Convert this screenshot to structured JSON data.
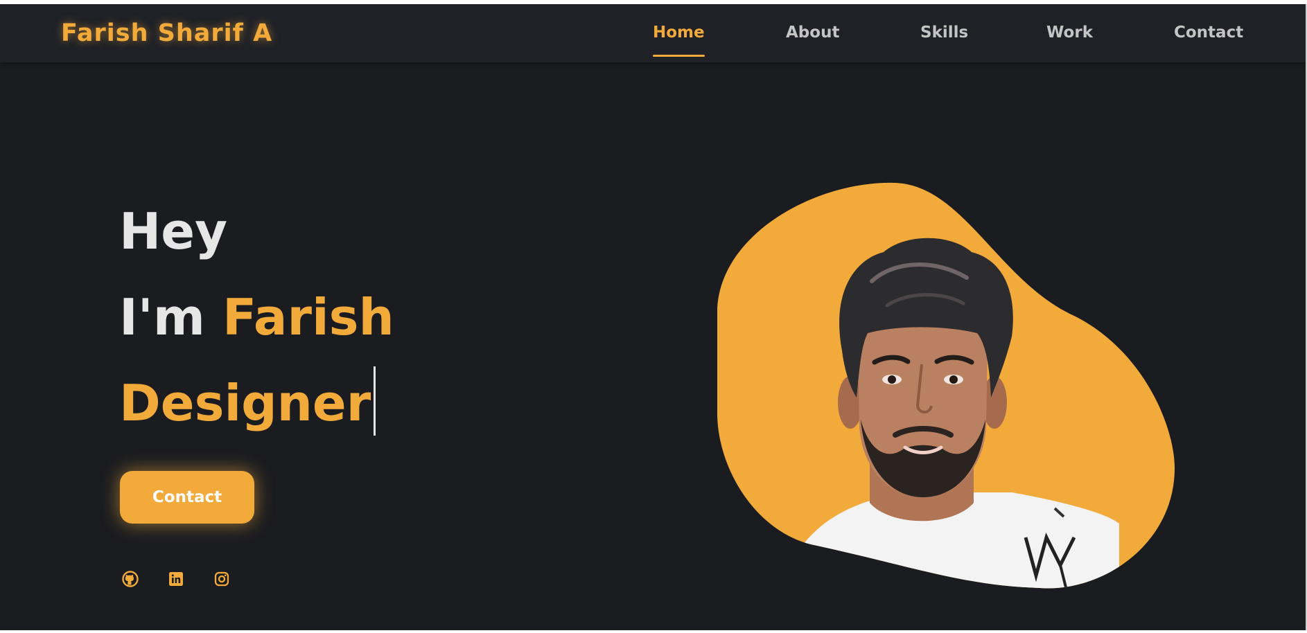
{
  "brand": {
    "name": "Farish Sharif A"
  },
  "nav": {
    "items": [
      {
        "label": "Home",
        "active": true
      },
      {
        "label": "About",
        "active": false
      },
      {
        "label": "Skills",
        "active": false
      },
      {
        "label": "Work",
        "active": false
      },
      {
        "label": "Contact",
        "active": false
      }
    ]
  },
  "hero": {
    "greeting": "Hey",
    "intro_prefix": "I'm",
    "name": "Farish",
    "role": "Designer",
    "button_label": "Contact"
  },
  "socials": [
    {
      "icon": "github-icon"
    },
    {
      "icon": "linkedin-icon"
    },
    {
      "icon": "instagram-icon"
    }
  ],
  "colors": {
    "background": "#1b1c20",
    "navbar": "#1f2127",
    "accent": "#f2ab3b",
    "text_light": "#e6e6e6",
    "text_muted": "#c4c4c4"
  }
}
